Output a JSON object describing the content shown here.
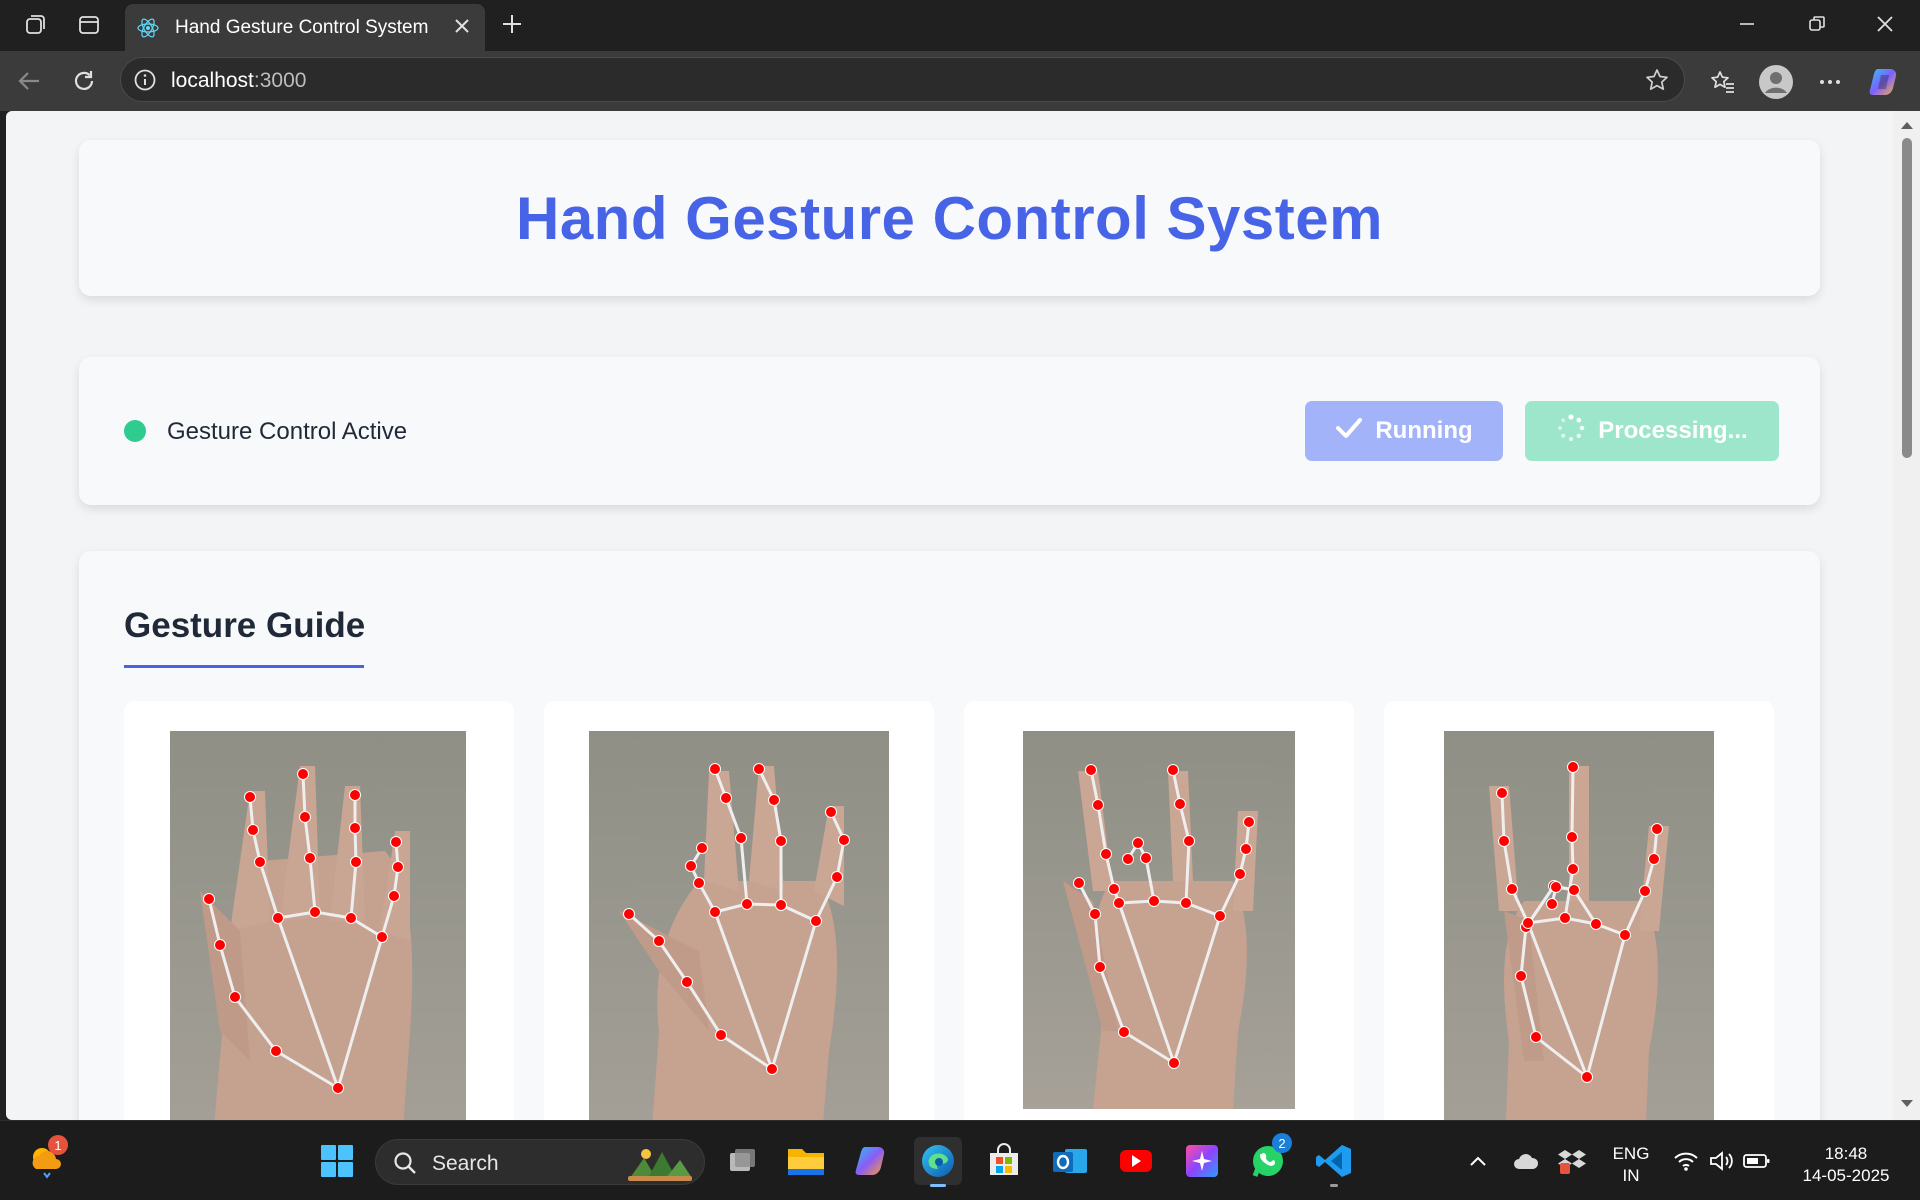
{
  "browser": {
    "tab_title": "Hand Gesture Control System",
    "url_host": "localhost",
    "url_path": ":3000"
  },
  "page": {
    "title": "Hand Gesture Control System",
    "status_text": "Gesture Control Active",
    "status_color": "#2fcc8f",
    "running_label": "Running",
    "processing_label": "Processing...",
    "accent_color": "#4763e6",
    "guide_title": "Gesture Guide",
    "gestures": [
      {
        "icon": "open-palm-landmarks-image"
      },
      {
        "icon": "thumb-index-pinch-landmarks-image"
      },
      {
        "icon": "middle-thumb-pinch-landmarks-image"
      },
      {
        "icon": "ring-thumb-pinch-landmarks-image"
      }
    ]
  },
  "taskbar": {
    "search_label": "Search",
    "notification_badge": "1",
    "whatsapp_badge": "2",
    "language_line1": "ENG",
    "language_line2": "IN",
    "time": "18:48",
    "date": "14-05-2025"
  }
}
